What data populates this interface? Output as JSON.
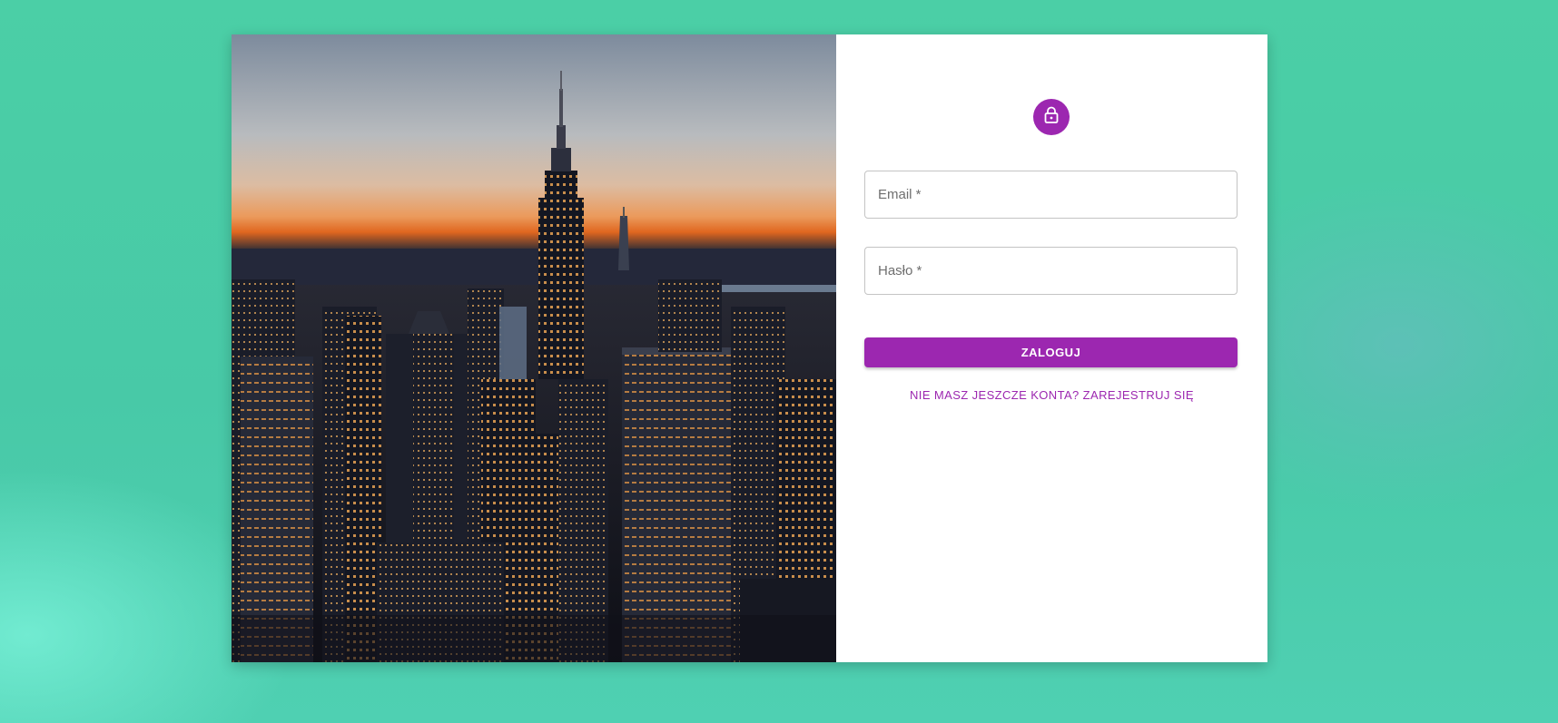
{
  "login": {
    "email_placeholder": "Email *",
    "password_placeholder": "Hasło *",
    "submit_label": "ZALOGUJ",
    "register_link": "NIE MASZ JESZCZE KONTA? ZAREJESTRUJ SIĘ"
  },
  "colors": {
    "accent": "#9c27b0",
    "background": "#4bcfa6",
    "panel": "#ffffff"
  },
  "icons": {
    "avatar": "lock-icon"
  }
}
